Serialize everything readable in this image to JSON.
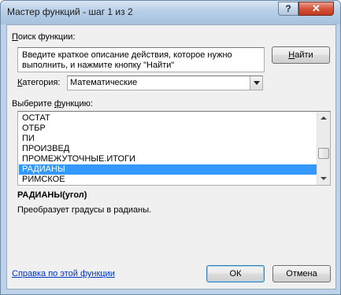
{
  "window": {
    "title": "Мастер функций - шаг 1 из 2",
    "help_label": "?",
    "close_label": "✕"
  },
  "search": {
    "label_hotkey": "П",
    "label_rest": "оиск функции:",
    "description": "Введите краткое описание действия, которое нужно выполнить, и нажмите кнопку \"Найти\"",
    "find_hotkey": "Н",
    "find_rest": "айти"
  },
  "category": {
    "label_hotkey": "К",
    "label_rest": "атегория:",
    "selected": "Математические"
  },
  "function_list": {
    "label_before": "Выберите ",
    "label_hotkey": "ф",
    "label_after": "ункцию:",
    "items": [
      "ОСТАТ",
      "ОТБР",
      "ПИ",
      "ПРОИЗВЕД",
      "ПРОМЕЖУТОЧНЫЕ.ИТОГИ",
      "РАДИАНЫ",
      "РИМСКОЕ"
    ],
    "selected_index": 5
  },
  "function_info": {
    "signature": "РАДИАНЫ(угол)",
    "description": "Преобразует градусы в радианы."
  },
  "footer": {
    "help_link": "Справка по этой функции",
    "ok_label": "ОК",
    "cancel_label": "Отмена"
  },
  "colors": {
    "selection": "#3399ff",
    "link": "#0033cc"
  }
}
